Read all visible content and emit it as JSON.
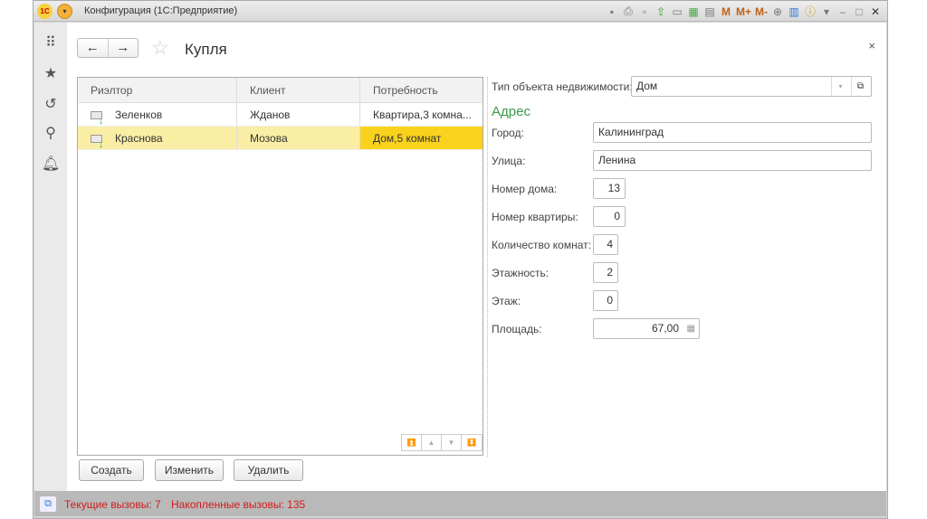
{
  "window": {
    "logo": "1С",
    "title": "Конфигурация  (1С:Предприятие)"
  },
  "toolbar": {
    "m": "M",
    "mplus": "M+",
    "mminus": "M-"
  },
  "form": {
    "title": "Купля",
    "close": "×"
  },
  "table": {
    "columns": [
      "Риэлтор",
      "Клиент",
      "Потребность"
    ],
    "rows": [
      {
        "realtor": "Зеленков",
        "client": "Жданов",
        "need": "Квартира,3 комна..."
      },
      {
        "realtor": "Краснова",
        "client": "Мозова",
        "need": "Дом,5 комнат"
      }
    ]
  },
  "buttons": {
    "create": "Создать",
    "edit": "Изменить",
    "delete": "Удалить"
  },
  "details": {
    "type_label": "Тип объекта недвижимости:",
    "type_value": "Дом",
    "section": "Адрес",
    "city_label": "Город:",
    "city": "Калининград",
    "street_label": "Улица:",
    "street": "Ленина",
    "house_label": "Номер дома:",
    "house": "13",
    "apt_label": "Номер квартиры:",
    "apt": "0",
    "rooms_label": "Количество комнат:",
    "rooms": "4",
    "floors_label": "Этажность:",
    "floors": "2",
    "floor_label": "Этаж:",
    "floor": "0",
    "area_label": "Площадь:",
    "area": "67,00"
  },
  "status": {
    "current": "Текущие вызовы: 7",
    "accumulated": "Накопленные вызовы: 135"
  },
  "colors": {
    "selected_row": "#faeea5",
    "selected_cell": "#f9d21d",
    "section": "#3a9a4a",
    "status_text": "#d01c1c"
  }
}
